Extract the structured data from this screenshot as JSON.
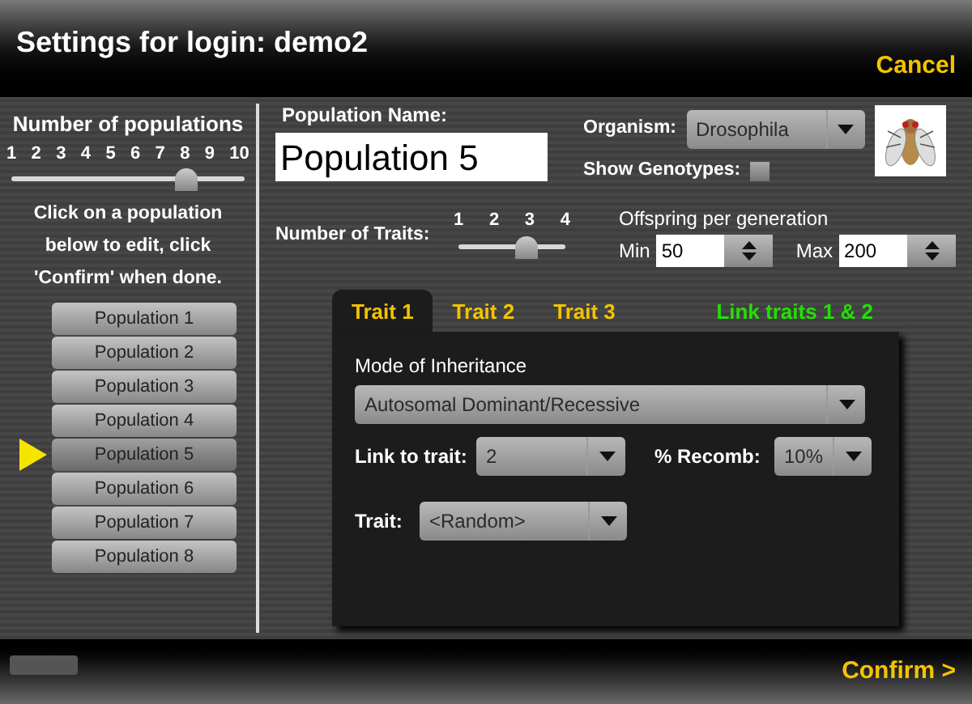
{
  "window": {
    "title": "Settings for login: demo2",
    "cancel": "Cancel",
    "confirm": "Confirm >"
  },
  "populations": {
    "heading": "Number of populations",
    "ticks": [
      "1",
      "2",
      "3",
      "4",
      "5",
      "6",
      "7",
      "8",
      "9",
      "10"
    ],
    "level": 0.778,
    "instructions": "Click on a population below to edit, click 'Confirm' when done.",
    "items": [
      {
        "label": "Population 1",
        "selected": false
      },
      {
        "label": "Population 2",
        "selected": false
      },
      {
        "label": "Population 3",
        "selected": false
      },
      {
        "label": "Population 4",
        "selected": false
      },
      {
        "label": "Population 5",
        "selected": true
      },
      {
        "label": "Population 6",
        "selected": false
      },
      {
        "label": "Population 7",
        "selected": false
      },
      {
        "label": "Population 8",
        "selected": false
      }
    ]
  },
  "population_name": {
    "label": "Population Name:",
    "value": "Population 5"
  },
  "organism": {
    "label": "Organism:",
    "value": "Drosophila"
  },
  "show_genotypes": {
    "label": "Show Genotypes:",
    "checked": false
  },
  "traits": {
    "label": "Number of Traits:",
    "ticks": [
      "1",
      "2",
      "3",
      "4"
    ],
    "level": 0.667
  },
  "offspring": {
    "heading": "Offspring per generation",
    "min_label": "Min",
    "min": "50",
    "max_label": "Max",
    "max": "200"
  },
  "tabs": [
    {
      "label": "Trait 1",
      "selected": true
    },
    {
      "label": "Trait 2",
      "selected": false
    },
    {
      "label": "Trait 3",
      "selected": false
    }
  ],
  "link_traits": "Link traits 1 & 2",
  "panel": {
    "mode_label": "Mode of Inheritance",
    "mode": "Autosomal Dominant/Recessive",
    "link_label": "Link to trait:",
    "link": "2",
    "recomb_label": "% Recomb:",
    "recomb": "10%",
    "trait_label": "Trait:",
    "trait": "<Random>"
  }
}
